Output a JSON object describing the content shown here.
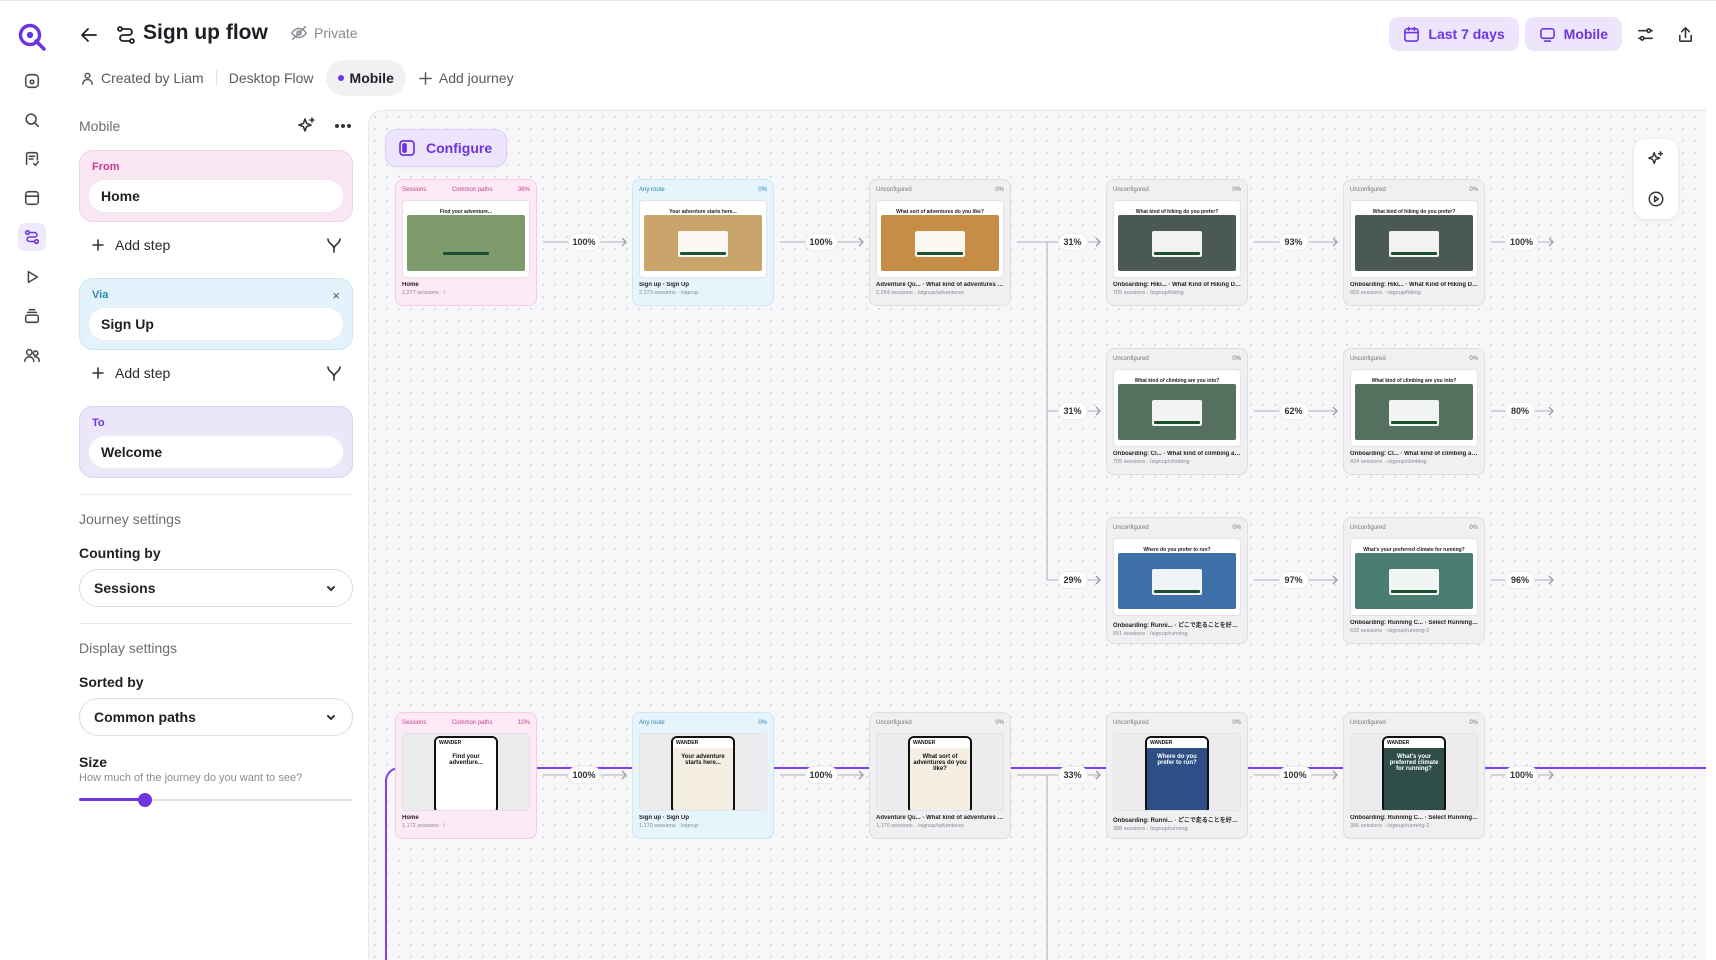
{
  "header": {
    "title": "Sign up flow",
    "privacy": "Private",
    "tabs": {
      "created_by": "Created by Liam",
      "desktop": "Desktop Flow",
      "mobile": "Mobile",
      "add": "Add journey"
    },
    "date_range": "Last 7 days",
    "device": "Mobile"
  },
  "panel": {
    "label": "Mobile",
    "from_label": "From",
    "from_value": "Home",
    "add_step": "Add step",
    "via_label": "Via",
    "via_value": "Sign Up",
    "via_remove": "×",
    "to_label": "To",
    "to_value": "Welcome",
    "journey_settings": "Journey settings",
    "counting_label": "Counting by",
    "counting_value": "Sessions",
    "display_settings": "Display settings",
    "sorted_label": "Sorted by",
    "sorted_value": "Common paths",
    "size_label": "Size",
    "size_hint": "How much of the journey do you want to see?",
    "size_value": 0.24
  },
  "canvas": {
    "configure": "Configure",
    "journey1": {
      "rows": [
        [
          {
            "kind": "from",
            "top_left": "Sessions",
            "top_mid": "Common paths",
            "top_right": "36%",
            "title": "Home",
            "sub": "2,277 sessions · /",
            "img": "#7c9a6a",
            "heading": "Find your adventure..."
          },
          {
            "kind": "via",
            "top_left": "Any route",
            "top_right": "0%",
            "title": "Sign up · Sign Up",
            "sub": "2,273 sessions · /signup",
            "img": "#c9a56c",
            "heading": "Your adventure starts here..."
          },
          {
            "kind": "step",
            "top_left": "Unconfigured",
            "top_right": "0%",
            "title": "Adventure Qu... · What kind of adventures do...",
            "sub": "2,264 sessions · /signup/adventures",
            "img": "#c58d46",
            "heading": "What sort of adventures do you like?"
          },
          {
            "kind": "step",
            "top_left": "Unconfigured",
            "top_right": "0%",
            "title": "Onboarding: Hiki... · What Kind of Hiking Do ...",
            "sub": "705 sessions · /signup/hiking",
            "img": "#4a5a53",
            "heading": "What kind of hiking do you prefer?"
          },
          {
            "kind": "step",
            "top_left": "Unconfigured",
            "top_right": "0%",
            "title": "Onboarding: Hiki... · What Kind of Hiking Do ...",
            "sub": "659 sessions · /signup/hiking",
            "img": "#4a5a53",
            "heading": "What kind of hiking do you prefer?"
          }
        ],
        [
          {
            "kind": "step",
            "top_left": "Unconfigured",
            "top_right": "0%",
            "title": "Onboarding: Cl... · What kind of climbing are ...",
            "sub": "705 sessions · /signup/climbing",
            "img": "#55705f",
            "heading": "What kind of climbing are you into?"
          },
          {
            "kind": "step",
            "top_left": "Unconfigured",
            "top_right": "0%",
            "title": "Onboarding: Cl... · What kind of climbing are ...",
            "sub": "434 sessions · /signup/climbing",
            "img": "#55705f",
            "heading": "What kind of climbing are you into?"
          }
        ],
        [
          {
            "kind": "step",
            "top_left": "Unconfigured",
            "top_right": "0%",
            "title": "Onboarding: Runni... · どこで走ることを好み...",
            "sub": "651 sessions · /signup/running",
            "img": "#3d6fa8",
            "heading": "Where do you prefer to run?"
          },
          {
            "kind": "step",
            "top_left": "Unconfigured",
            "top_right": "0%",
            "title": "Onboarding: Running C... · Select Running Cli...",
            "sub": "632 sessions · /signup/running-2",
            "img": "#4c7d73",
            "heading": "What's your preferred climate for running?"
          }
        ]
      ],
      "row1_pcts": [
        "100%",
        "100%",
        "31%",
        "93%",
        "100%"
      ],
      "row2_pcts": [
        "31%",
        "62%",
        "80%"
      ],
      "row3_pcts": [
        "29%",
        "97%",
        "96%"
      ]
    },
    "journey2": {
      "cards": [
        {
          "kind": "from",
          "top_left": "Sessions",
          "top_mid": "Common paths",
          "top_right": "10%",
          "title": "Home",
          "sub": "1,172 sessions · /",
          "img": "#ffffff",
          "heading": "Find your adventure..."
        },
        {
          "kind": "via",
          "top_left": "Any route",
          "top_right": "0%",
          "title": "Sign up · Sign Up",
          "sub": "1,170 sessions · /signup",
          "img": "#f4efe2",
          "heading": "Your adventure starts here..."
        },
        {
          "kind": "step",
          "top_left": "Unconfigured",
          "top_right": "0%",
          "title": "Adventure Qu... · What kind of adventures do...",
          "sub": "1,170 sessions · /signup/adventures",
          "img": "#f4efe2",
          "heading": "What sort of adventures do you like?"
        },
        {
          "kind": "step",
          "top_left": "Unconfigured",
          "top_right": "0%",
          "title": "Onboarding: Runni... · どこで走ることを好み...",
          "sub": "388 sessions · /signup/running",
          "img": "#2e4f86",
          "heading": "Where do you prefer to run?"
        },
        {
          "kind": "step",
          "top_left": "Unconfigured",
          "top_right": "0%",
          "title": "Onboarding: Running C... · Select Running Cli...",
          "sub": "386 sessions · /signup/running-2",
          "img": "#2f4e48",
          "heading": "What's your preferred climate for running?"
        }
      ],
      "brand": "WANDER",
      "pcts": [
        "100%",
        "100%",
        "33%",
        "100%",
        "100%"
      ]
    }
  },
  "colors": {
    "accent": "#6d35e0",
    "from": "#c43a8e",
    "via": "#2a86b7"
  }
}
